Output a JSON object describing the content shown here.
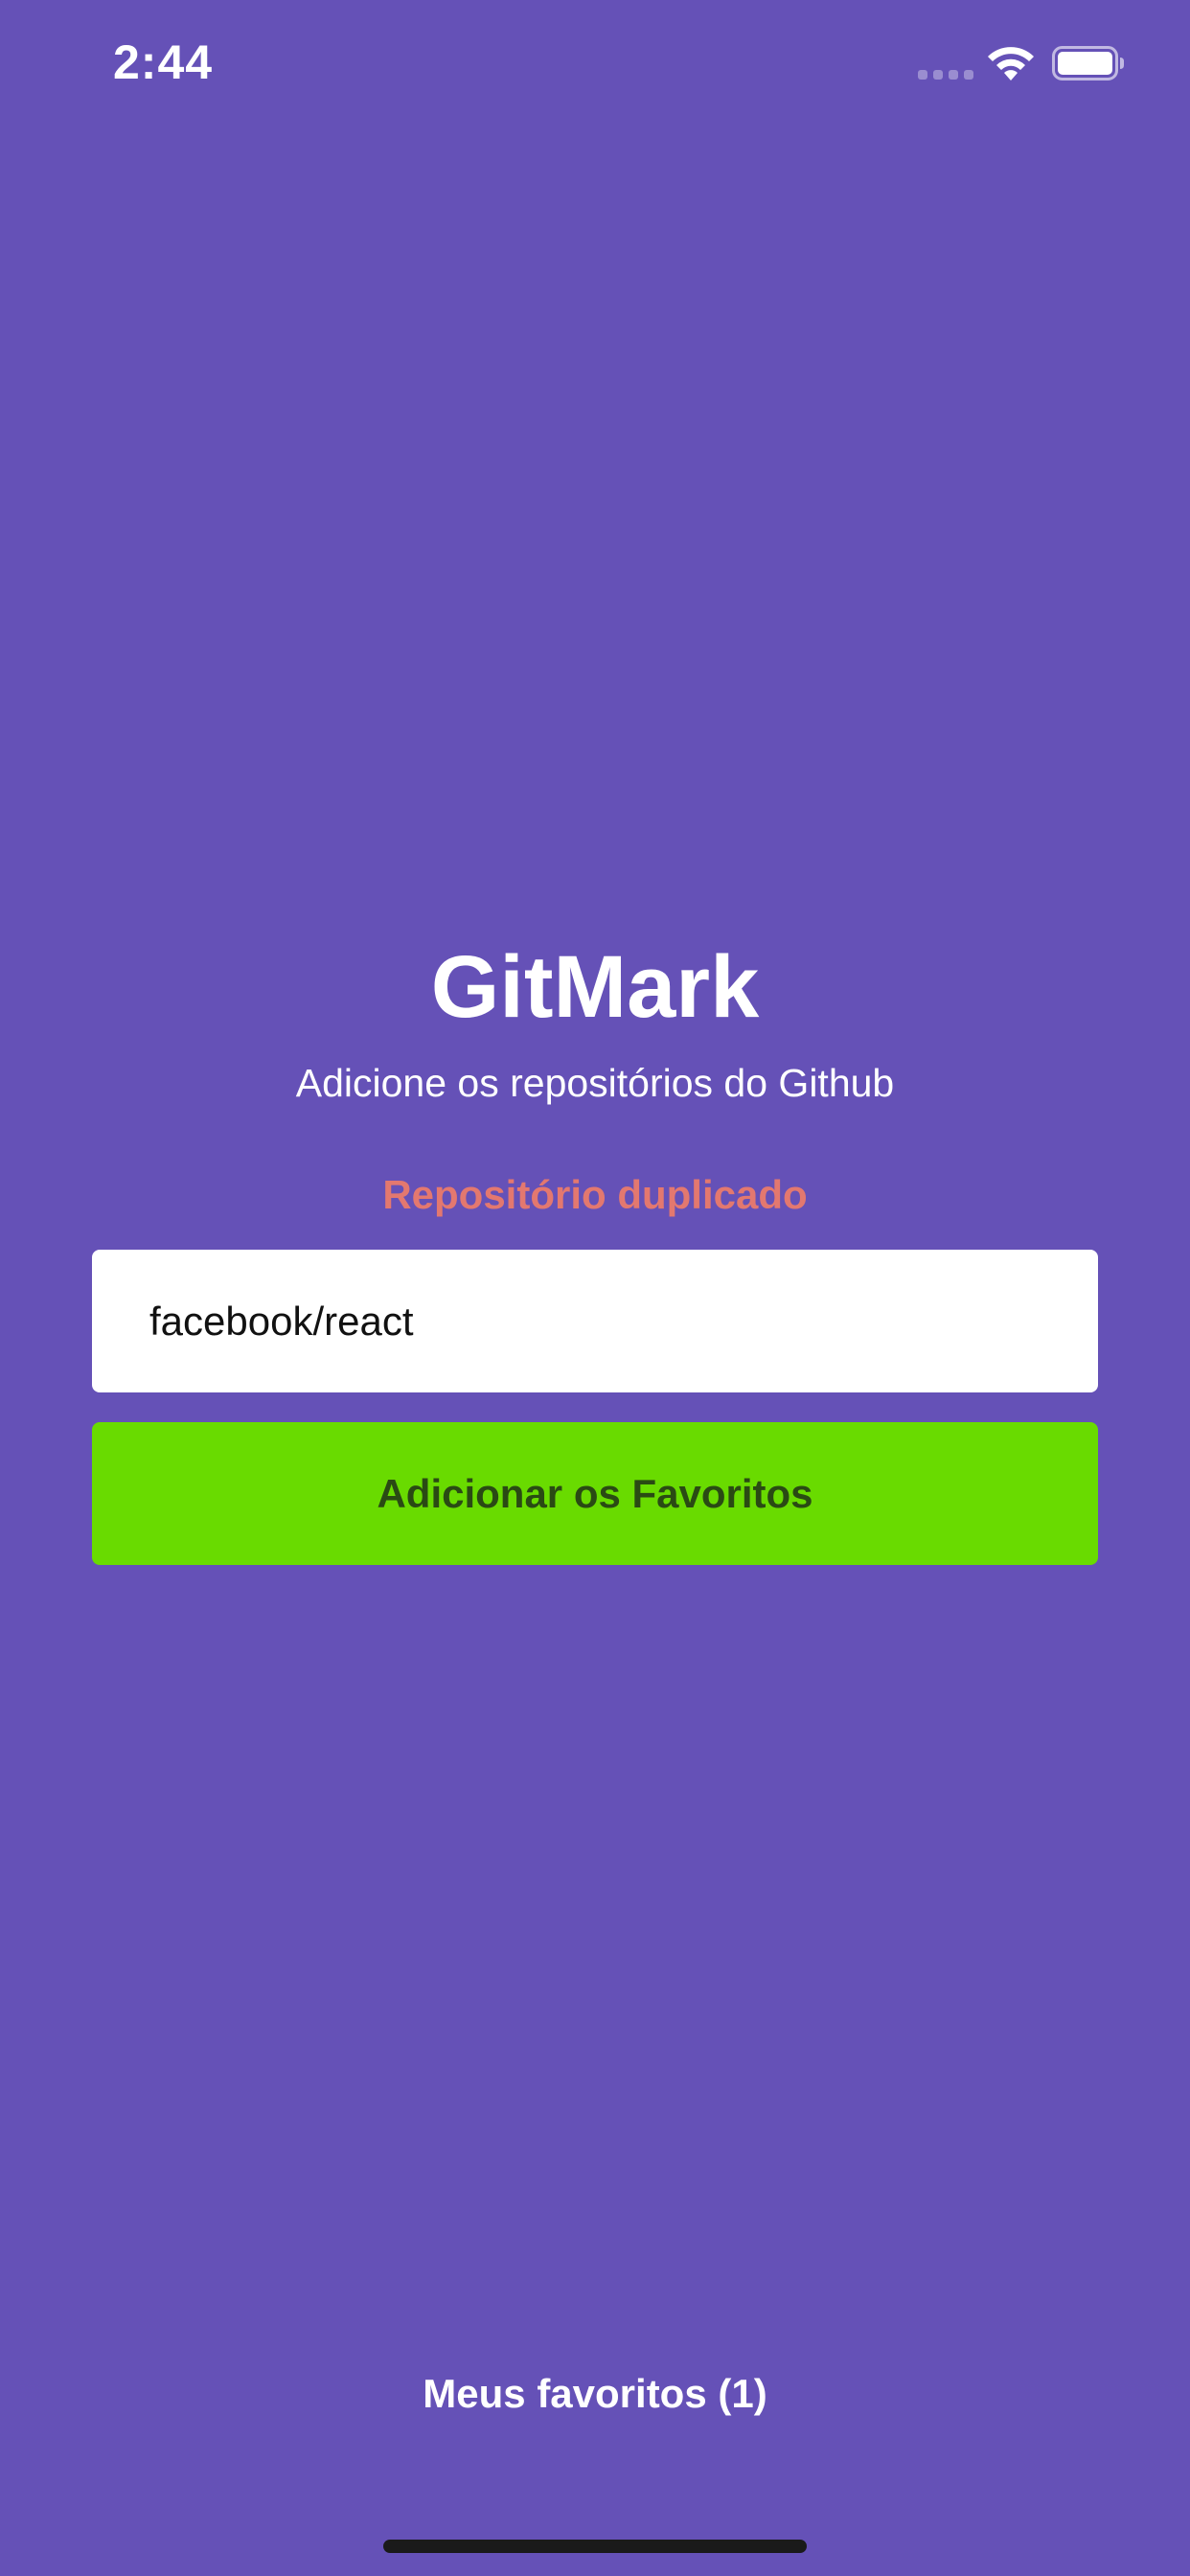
{
  "status_bar": {
    "time": "2:44",
    "icons": [
      "cellular-signal-icon",
      "wifi-icon",
      "battery-icon"
    ]
  },
  "main": {
    "title": "GitMark",
    "subtitle": "Adicione os repositórios do Github",
    "error_message": "Repositório duplicado",
    "repo_input": {
      "value": "facebook/react",
      "placeholder": ""
    },
    "add_button_label": "Adicionar os Favoritos",
    "favorites_link": "Meus favoritos (1)"
  },
  "colors": {
    "background": "#6551b7",
    "error_text": "#e3786f",
    "button_background": "#69db00",
    "button_text": "#2a4a14",
    "input_background": "#ffffff"
  }
}
